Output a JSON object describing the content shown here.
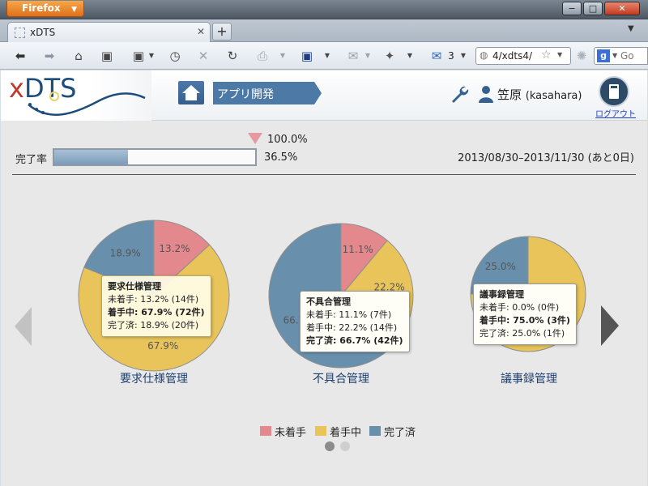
{
  "browser": {
    "menu_label": "Firefox",
    "tab_title": "xDTS",
    "url": "4/xdts4/",
    "mail_count": "3",
    "search_engine_letter": "g",
    "search_placeholder": "Go"
  },
  "app": {
    "logo": "xDTS",
    "breadcrumb": "アプリ開発",
    "user_name": "笠原",
    "user_login": "(kasahara)",
    "logout_label": "ログアウト"
  },
  "progress": {
    "label": "完了率",
    "target_label": "100.0%",
    "value_label": "36.5%",
    "fraction": 0.365,
    "period": "2013/08/30–2013/11/30 (あと0日)"
  },
  "colors": {
    "not_started": "#e3888d",
    "in_progress": "#e8c45a",
    "done": "#6890ad"
  },
  "chart_data": [
    {
      "type": "pie",
      "title": "要求仕様管理",
      "categories": [
        "未着手",
        "着手中",
        "完了済"
      ],
      "values": [
        14,
        72,
        20
      ],
      "slice_labels": [
        "13.2%",
        "67.9%",
        "18.9%"
      ],
      "tooltip": {
        "title": "要求仕様管理",
        "lines": [
          "未着手: 13.2% (14件)",
          "着手中: 67.9% (72件)",
          "完了済: 18.9% (20件)"
        ],
        "highlight": 1
      }
    },
    {
      "type": "pie",
      "title": "不具合管理",
      "categories": [
        "未着手",
        "着手中",
        "完了済"
      ],
      "values": [
        7,
        14,
        42
      ],
      "slice_labels": [
        "11.1%",
        "22.2%",
        "66.7%"
      ],
      "tooltip": {
        "title": "不具合管理",
        "lines": [
          "未着手: 11.1% (7件)",
          "着手中: 22.2% (14件)",
          "完了済: 66.7% (42件)"
        ],
        "highlight": 2
      }
    },
    {
      "type": "pie",
      "title": "議事録管理",
      "categories": [
        "未着手",
        "着手中",
        "完了済"
      ],
      "values": [
        0,
        3,
        1
      ],
      "slice_labels": [
        "0.0%",
        "75.0%",
        "25.0%"
      ],
      "tooltip": {
        "title": "議事録管理",
        "lines": [
          "未着手: 0.0% (0件)",
          "着手中: 75.0% (3件)",
          "完了済: 25.0% (1件)"
        ],
        "highlight": 1
      }
    }
  ],
  "legend": [
    "未着手",
    "着手中",
    "完了済"
  ],
  "carousel": {
    "pages": 2,
    "active": 0
  }
}
